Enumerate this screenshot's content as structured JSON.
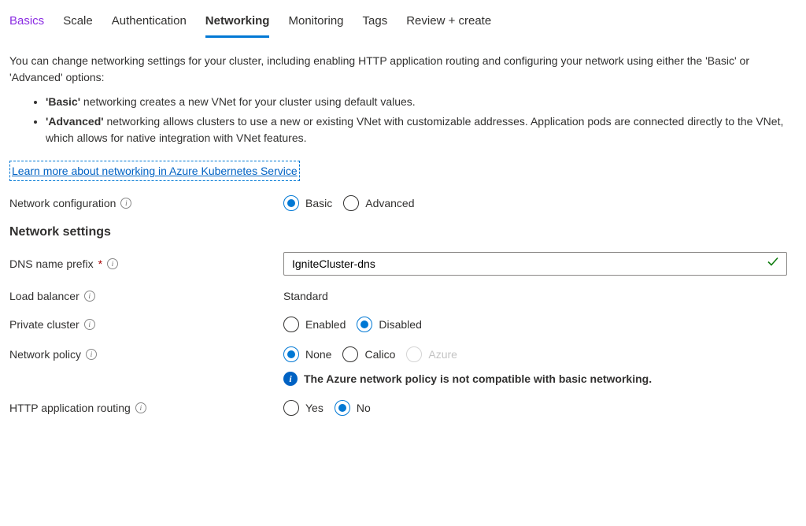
{
  "tabs": {
    "items": [
      {
        "label": "Basics",
        "highlight": true
      },
      {
        "label": "Scale"
      },
      {
        "label": "Authentication"
      },
      {
        "label": "Networking",
        "active": true
      },
      {
        "label": "Monitoring"
      },
      {
        "label": "Tags"
      },
      {
        "label": "Review + create"
      }
    ]
  },
  "intro": {
    "text": "You can change networking settings for your cluster, including enabling HTTP application routing and configuring your network using either the 'Basic' or 'Advanced' options:",
    "bullets": [
      {
        "boldPrefix": "'Basic'",
        "rest": " networking creates a new VNet for your cluster using default values."
      },
      {
        "boldPrefix": "'Advanced'",
        "rest": " networking allows clusters to use a new or existing VNet with customizable addresses. Application pods are connected directly to the VNet, which allows for native integration with VNet features."
      }
    ],
    "learnLink": "Learn more about networking in Azure Kubernetes Service"
  },
  "form": {
    "networkConfig": {
      "label": "Network configuration",
      "options": {
        "basic": "Basic",
        "advanced": "Advanced"
      },
      "selected": "basic"
    },
    "sectionTitle": "Network settings",
    "dnsPrefix": {
      "label": "DNS name prefix",
      "required": "*",
      "value": "IgniteCluster-dns"
    },
    "loadBalancer": {
      "label": "Load balancer",
      "value": "Standard"
    },
    "privateCluster": {
      "label": "Private cluster",
      "options": {
        "enabled": "Enabled",
        "disabled": "Disabled"
      },
      "selected": "disabled"
    },
    "networkPolicy": {
      "label": "Network policy",
      "options": {
        "none": "None",
        "calico": "Calico",
        "azure": "Azure"
      },
      "selected": "none",
      "disabledOption": "azure",
      "infoNote": "The Azure network policy is not compatible with basic networking."
    },
    "httpRouting": {
      "label": "HTTP application routing",
      "options": {
        "yes": "Yes",
        "no": "No"
      },
      "selected": "no"
    }
  }
}
